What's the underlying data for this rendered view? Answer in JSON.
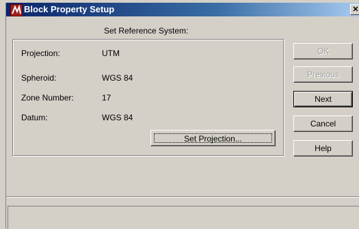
{
  "window": {
    "title": "Block Property Setup",
    "close_glyph": "✕"
  },
  "header": {
    "subtitle": "Set Reference System:"
  },
  "reference": {
    "rows": [
      {
        "label": "Projection:",
        "value": "UTM"
      },
      {
        "label": "Spheroid:",
        "value": "WGS 84"
      },
      {
        "label": "Zone Number:",
        "value": "17"
      },
      {
        "label": "Datum:",
        "value": "WGS 84"
      }
    ],
    "set_projection_label": "Set Projection..."
  },
  "buttons": {
    "ok": {
      "label": "OK",
      "enabled": false
    },
    "previous": {
      "label": "Previous",
      "enabled": false
    },
    "next": {
      "label": "Next",
      "enabled": true
    },
    "cancel": {
      "label": "Cancel",
      "enabled": true
    },
    "help": {
      "label": "Help",
      "enabled": true
    }
  },
  "colors": {
    "titlebar_start": "#0a246a",
    "titlebar_end": "#a6caf0",
    "face": "#d4d0c8",
    "disabled_text": "#a0a0a0"
  },
  "icons": {
    "app": "app-icon",
    "close": "close-icon"
  }
}
